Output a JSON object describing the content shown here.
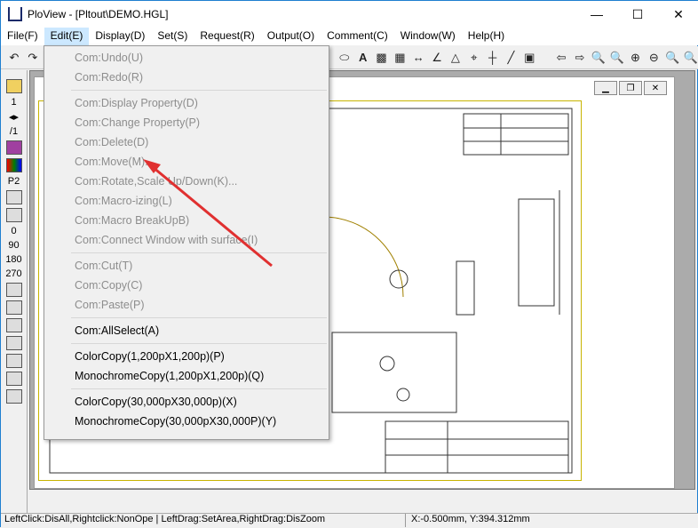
{
  "window": {
    "title": "PloView - [Pltout\\DEMO.HGL]",
    "minimize": "—",
    "maximize": "☐",
    "close": "✕"
  },
  "menubar": [
    "File(F)",
    "Edit(E)",
    "Display(D)",
    "Set(S)",
    "Request(R)",
    "Output(O)",
    "Comment(C)",
    "Window(W)",
    "Help(H)"
  ],
  "edit_menu": {
    "groups": [
      [
        {
          "label": "Com:Undo(U)",
          "enabled": false
        },
        {
          "label": "Com:Redo(R)",
          "enabled": false
        }
      ],
      [
        {
          "label": "Com:Display Property(D)",
          "enabled": false
        },
        {
          "label": "Com:Change Property(P)",
          "enabled": false
        },
        {
          "label": "Com:Delete(D)",
          "enabled": false
        },
        {
          "label": "Com:Move(M)...",
          "enabled": false
        },
        {
          "label": "Com:Rotate,Scale Up/Down(K)...",
          "enabled": false
        },
        {
          "label": "Com:Macro-izing(L)",
          "enabled": false
        },
        {
          "label": "Com:Macro BreakUpB)",
          "enabled": false
        },
        {
          "label": "Com:Connect Window with surface(I)",
          "enabled": false
        }
      ],
      [
        {
          "label": "Com:Cut(T)",
          "enabled": false
        },
        {
          "label": "Com:Copy(C)",
          "enabled": false
        },
        {
          "label": "Com:Paste(P)",
          "enabled": false
        }
      ],
      [
        {
          "label": "Com:AllSelect(A)",
          "enabled": true
        }
      ],
      [
        {
          "label": "ColorCopy(1,200pX1,200p)(P)",
          "enabled": true
        },
        {
          "label": "MonochromeCopy(1,200pX1,200p)(Q)",
          "enabled": true
        }
      ],
      [
        {
          "label": "ColorCopy(30,000pX30,000p)(X)",
          "enabled": true
        },
        {
          "label": "MonochromeCopy(30,000pX30,000P)(Y)",
          "enabled": true
        }
      ]
    ]
  },
  "left_toolbar": {
    "page": "1",
    "page_total": "/1",
    "pen": "P2",
    "angles": [
      "0",
      "90",
      "180",
      "270"
    ]
  },
  "status": {
    "hint": "LeftClick:DisAll,Rightclick:NonOpe  |  LeftDrag:SetArea,RightDrag:DisZoom",
    "coords": "X:-0.500mm, Y:394.312mm"
  },
  "colors": {
    "accent": "#cce8ff",
    "arrow": "#e03030",
    "frame": "#c8b400"
  }
}
